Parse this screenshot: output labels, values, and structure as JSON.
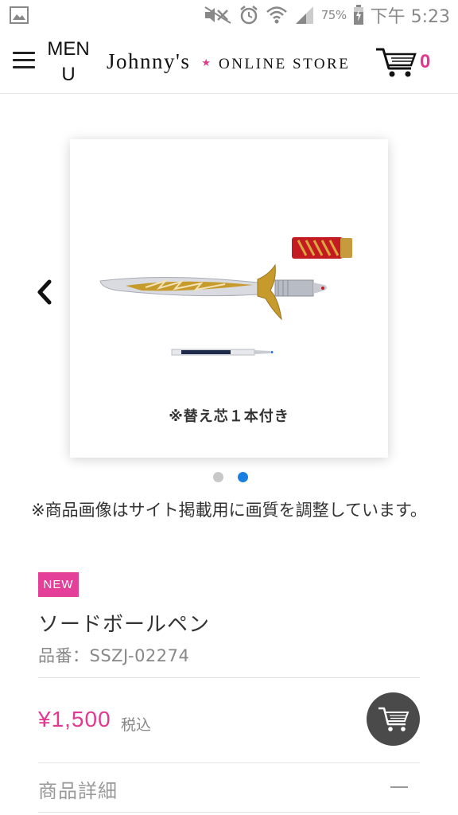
{
  "status_bar": {
    "battery_percent": "75%",
    "time": "下午 5:23",
    "icons": [
      "image-icon",
      "mute-icon",
      "alarm-icon",
      "wifi-icon",
      "signal-icon",
      "battery-icon"
    ]
  },
  "header": {
    "menu_label": "MENU",
    "logo_name": "Johnny's",
    "logo_star": "★",
    "logo_store": "ONLINE STORE",
    "cart_count": "0"
  },
  "carousel": {
    "caption": "※替え芯１本付き",
    "total_slides": 2,
    "active_slide": 2,
    "colors": {
      "dot_inactive": "#c8c8c8",
      "dot_active": "#1a7fe0"
    }
  },
  "notice": "※商品画像はサイト掲載用に画質を調整しています。",
  "product": {
    "badge": "NEW",
    "name": "ソードボールペン",
    "code": "品番：SSZJ-02274",
    "price": "¥1,500",
    "tax_label": "税込",
    "details_label": "商品詳細",
    "details_toggle": "—"
  },
  "colors": {
    "accent": "#e2388f",
    "badge_bg": "#e4409a",
    "fab_bg": "#4a4a4a"
  }
}
